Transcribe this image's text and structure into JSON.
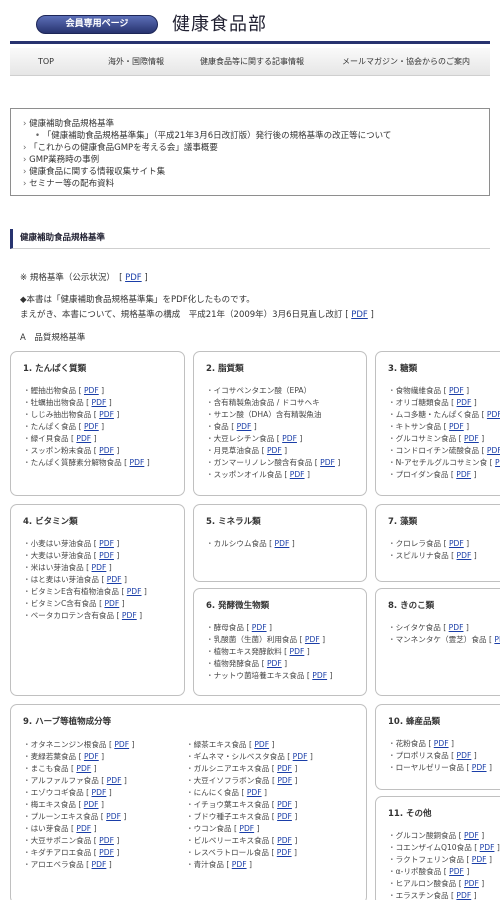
{
  "header": {
    "member_label": "会員専用ページ",
    "title": "健康食品部"
  },
  "nav": {
    "items": [
      "TOP",
      "海外・国際情報",
      "健康食品等に関する記事情報",
      "メールマガジン・協会からのご案内"
    ]
  },
  "info": {
    "lines": [
      "健康補助食品規格基準",
      "「健康補助食品規格基準集」（平成21年3月6日改訂版）発行後の規格基準の改正等について",
      "「これからの健康食品GMPを考える会」議事概要",
      "GMP業務時の事例",
      "健康食品に関する情報収集サイト集",
      "セミナー等の配布資料"
    ]
  },
  "section": {
    "heading": "健康補助食品規格基準",
    "note": "※ 規格基準（公示状況）",
    "pdf": "PDF",
    "line1": "◆本書は「健康補助食品規格基準集」をPDF化したものです。",
    "line2": "まえがき、本書について、規格基準の構成　平成21年（2009年）3月6日見直し改訂",
    "subhead": "A　品質規格基準"
  },
  "cards": {
    "c1": {
      "title": "1. たんぱく質類",
      "items": [
        "鰹抽出物食品",
        "牡蠣抽出物食品",
        "しじみ抽出物食品",
        "たんぱく食品",
        "緑イ貝食品",
        "スッポン粉末食品",
        "たんぱく質酵素分解物食品"
      ]
    },
    "c2": {
      "title": "2. 脂質類",
      "items": [
        "イコサペンタエン酸（EPA）",
        "含有精製魚油食品 / ドコサヘキ",
        "サエン酸（DHA）含有精製魚油",
        "食品",
        "大豆レシチン食品",
        "月見草油食品",
        "ガンマーリノレン酸含有食品",
        "スッポンオイル食品"
      ]
    },
    "c3": {
      "title": "3. 糖類",
      "items": [
        "食物繊維食品",
        "オリゴ糖類食品",
        "ムコ多糖・たんぱく食品",
        "キトサン食品",
        "グルコサミン食品",
        "コンドロイチン硫酸食品",
        "N-アセチルグルコサミン食",
        "プロイダン食品"
      ]
    },
    "c4": {
      "title": "4. ビタミン類",
      "items": [
        "小麦はい芽油食品",
        "大麦はい芽油食品",
        "米はい芽油食品",
        "はと麦はい芽油食品",
        "ビタミンE含有植物油食品",
        "ビタミンC含有食品",
        "ベータカロテン含有食品"
      ]
    },
    "c5": {
      "title": "5. ミネラル類",
      "items": [
        "カルシウム食品"
      ]
    },
    "c6": {
      "title": "6. 発酵微生物類",
      "items": [
        "酵母食品",
        "乳酸菌（生菌）利用食品",
        "植物エキス発酵飲料",
        "植物発酵食品",
        "ナットウ菌培養エキス食品"
      ]
    },
    "c7": {
      "title": "7. 藻類",
      "items": [
        "クロレラ食品",
        "スピルリナ食品"
      ]
    },
    "c8": {
      "title": "8. きのこ類",
      "items": [
        "シイタケ食品",
        "マンネンタケ（霊芝）食品"
      ]
    },
    "c9": {
      "title": "9. ハーブ等植物成分等",
      "col1": [
        "オタネニンジン根食品",
        "麦緑若葉食品",
        "まこも食品",
        "アルファルファ食品",
        "エゾウコギ食品",
        "梅エキス食品",
        "プルーンエキス食品",
        "はい芽食品",
        "大豆サポニン食品",
        "キダチアロエ食品",
        "アロエベラ食品"
      ],
      "col2": [
        "緑茶エキス食品",
        "ギムネマ・シルベスタ食品",
        "ガルシニアエキス食品",
        "大豆イソフラボン食品",
        "にんにく食品",
        "イチョウ葉エキス食品",
        "ブドウ種子エキス食品",
        "ウコン食品",
        "ビルベリーエキス食品",
        "レスベラトロール食品",
        "青汁食品"
      ]
    },
    "c10": {
      "title": "10. 蜂産品類",
      "items": [
        "花粉食品",
        "プロポリス食品",
        "ローヤルゼリー食品"
      ]
    },
    "c11": {
      "title": "11. その他",
      "items": [
        "グルコン酸銅食品",
        "コエンザイムQ10食品",
        "ラクトフェリン食品",
        "α-リポ酸食品",
        "ヒアルロン酸食品",
        "エラスチン食品"
      ]
    }
  }
}
